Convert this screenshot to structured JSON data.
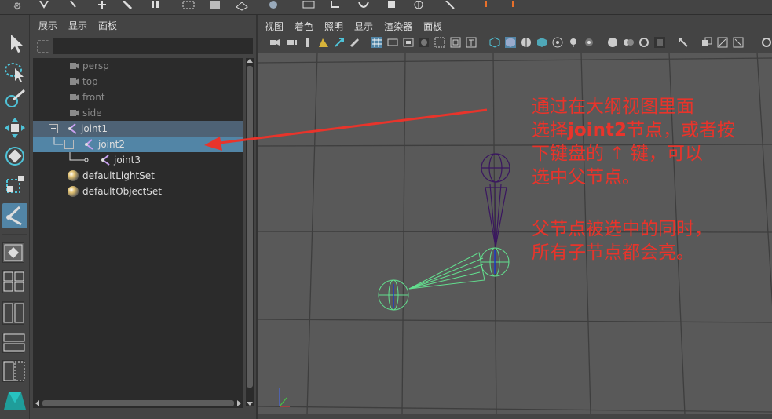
{
  "outliner": {
    "menu": [
      "展示",
      "显示",
      "面板"
    ],
    "items": [
      {
        "label": "persp"
      },
      {
        "label": "top"
      },
      {
        "label": "front"
      },
      {
        "label": "side"
      },
      {
        "label": "joint1"
      },
      {
        "label": "joint2"
      },
      {
        "label": "joint3"
      },
      {
        "label": "defaultLightSet"
      },
      {
        "label": "defaultObjectSet"
      }
    ],
    "selected": "joint2"
  },
  "viewport": {
    "menu": [
      "视图",
      "着色",
      "照明",
      "显示",
      "渲染器",
      "面板"
    ]
  },
  "annotation": {
    "line1": "通过在大纲视图里面",
    "line2_pre": "选择",
    "line2_bold": "joint2",
    "line2_post": "节点，或者按",
    "line3": "下键盘的 ↑ 键，可以",
    "line4": "选中父节点。",
    "line5": "父节点被选中的同时，",
    "line6": "所有子节点都会亮。"
  },
  "colors": {
    "selected_row": "#5285a6",
    "joint_parent": "#3a1660",
    "joint_child": "#63e08f",
    "annotation": "#e8342b"
  }
}
